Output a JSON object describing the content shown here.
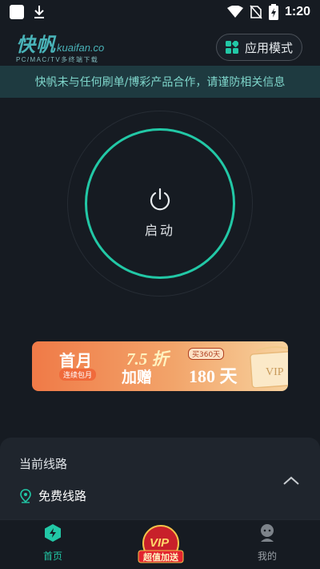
{
  "status_bar": {
    "time": "1:20",
    "icons": [
      "notification-square-icon",
      "download-icon",
      "wifi-icon",
      "no-sim-icon",
      "battery-charging-icon"
    ]
  },
  "header": {
    "logo_text": "快帆",
    "logo_domain": "kuaifan.co",
    "logo_tagline": "PC/MAC/TV多终端下载",
    "mode_button_label": "应用模式"
  },
  "notice": {
    "text": "快帆未与任何刷单/博彩产品合作，请谨防相关信息"
  },
  "power": {
    "label": "启动"
  },
  "banner": {
    "first_month": "首月",
    "subscription": "连续包月",
    "discount": "7.5 折",
    "bonus": "加赠",
    "strike_text": "买360天",
    "bonus_days": "180 天",
    "vip_text": "VIP"
  },
  "sheet": {
    "title": "当前线路",
    "line_name": "免费线路"
  },
  "tabbar": {
    "home_label": "首页",
    "vip_badge_top": "VIP",
    "vip_badge_text": "超值加送",
    "me_label": "我的"
  },
  "colors": {
    "background": "#161b22",
    "accent": "#22c8a6",
    "notice_bg": "#1e3a40",
    "notice_text": "#7fd6cb"
  }
}
